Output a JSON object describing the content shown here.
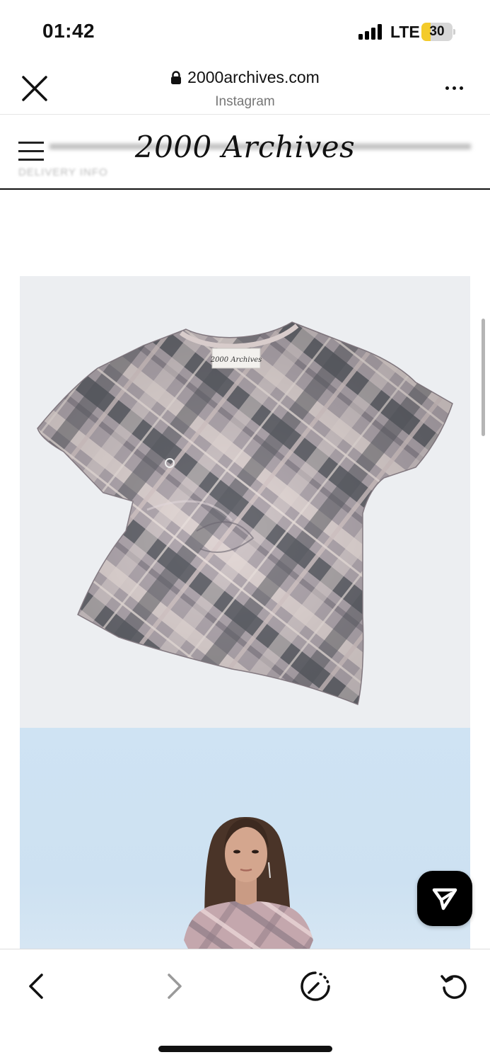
{
  "status_bar": {
    "time": "01:42",
    "network": "LTE",
    "battery_level": "30",
    "battery_fraction": 0.3
  },
  "browser": {
    "url": "2000archives.com",
    "source": "Instagram",
    "icons": {
      "close": "close-icon",
      "lock": "lock-icon",
      "more": "more-icon"
    }
  },
  "site": {
    "logo": "2000 Archives",
    "announcement": "DELIVERY INFO",
    "menu_icon": "hamburger-menu-icon"
  },
  "product": {
    "label_text": "2000 Archives",
    "images": [
      "plaid-tshirt-flatlay",
      "model-wearing-plaid-tshirt"
    ]
  },
  "share_button_icon": "send-icon",
  "toolbar": {
    "icons": [
      "back-icon",
      "forward-icon",
      "speed-icon",
      "reload-icon"
    ]
  },
  "colors": {
    "plaid_base": "#a79ea5",
    "plaid_dark": "#5a5d63",
    "plaid_light": "#e8dcd9",
    "image_bg": "#eceef1",
    "model_bg": "#cfe3f3",
    "battery_fill": "#f4cb2a"
  }
}
